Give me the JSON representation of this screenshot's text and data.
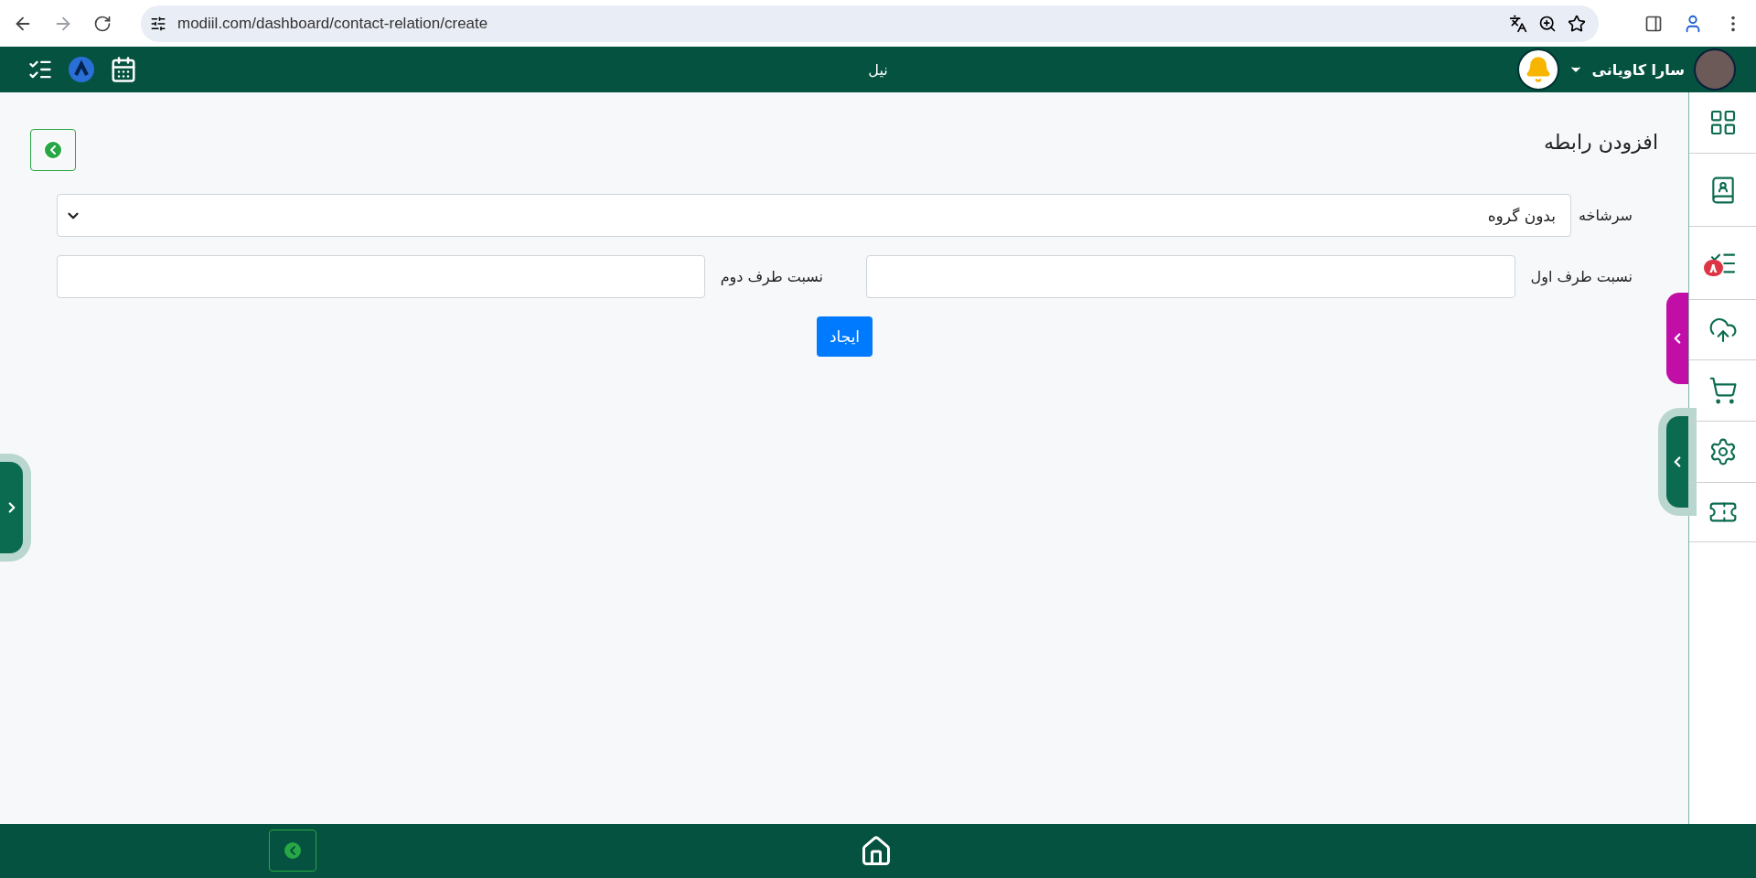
{
  "browser": {
    "url": "modiil.com/dashboard/contact-relation/create"
  },
  "header": {
    "title": "نیل",
    "user_name": "سارا کاویانی"
  },
  "sidebar": {
    "items": [
      {
        "kind": "grid"
      },
      {
        "kind": "contacts"
      },
      {
        "kind": "tasks",
        "badge": "۸"
      },
      {
        "kind": "upload"
      },
      {
        "kind": "cart"
      },
      {
        "kind": "settings"
      },
      {
        "kind": "ticket"
      }
    ]
  },
  "form": {
    "title": "افزودن رابطه",
    "parent": {
      "label": "سرشاخه",
      "value": "بدون گروه"
    },
    "first": {
      "label": "نسبت طرف اول"
    },
    "second": {
      "label": "نسبت طرف دوم"
    },
    "submit": "ایجاد"
  }
}
